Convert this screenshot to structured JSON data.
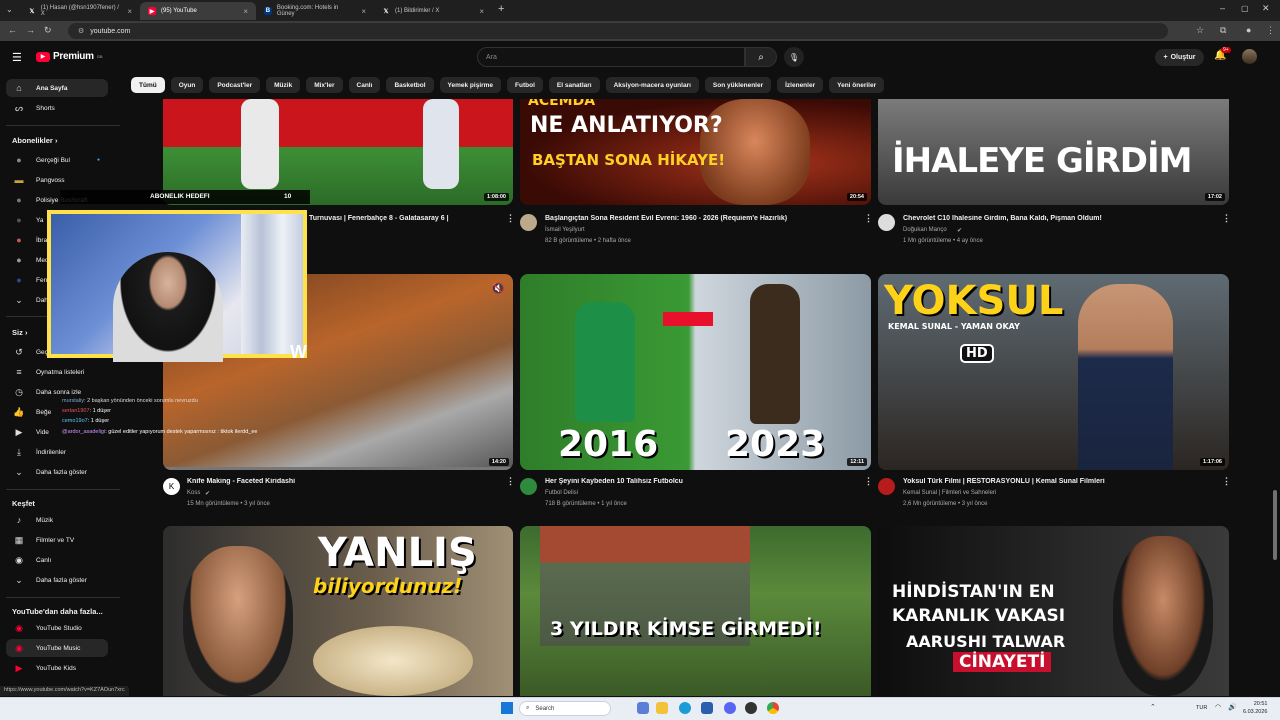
{
  "browser": {
    "tabs": [
      {
        "label": "(1) Hasan (@hsn1907fener) / X",
        "active": false
      },
      {
        "label": "(95) YouTube",
        "active": true
      },
      {
        "label": "Booking.com: Hotels in Güney",
        "active": false
      },
      {
        "label": "(1) Bildirimler / X",
        "active": false
      }
    ],
    "url": "youtube.com",
    "status_url": "https://www.youtube.com/watch?v=KZ7AOun7xrc"
  },
  "header": {
    "logo": "Premium",
    "logo_sup": "GB",
    "search_placeholder": "Ara",
    "create_label": "Oluştur",
    "notif_badge": "9+"
  },
  "chips": [
    "Tümü",
    "Oyun",
    "Podcast'ler",
    "Müzik",
    "Mix'ler",
    "Canlı",
    "Basketbol",
    "Yemek pişirme",
    "Futbol",
    "El sanatları",
    "Aksiyon-macera oyunları",
    "Son yüklenenler",
    "İzlenenler",
    "Yeni öneriler"
  ],
  "sidebar": {
    "home": "Ana Sayfa",
    "shorts": "Shorts",
    "subs_head": "Abonelikler",
    "subs": [
      "Gerçeği Bul",
      "Pangvoss",
      "Polisiye Bushcraft",
      "Ya",
      "İbra",
      "Mec",
      "Fen",
      "Dah"
    ],
    "you_head": "Siz",
    "you_items": [
      "Geç",
      "Oynatma listeleri",
      "Daha sonra izle",
      "Beğe",
      "Vide",
      "İndirilenler",
      "Daha fazla göster"
    ],
    "explore_head": "Keşfet",
    "explore_items": [
      "Müzik",
      "Filmler ve TV",
      "Canlı",
      "Daha fazla göster"
    ],
    "more_head": "YouTube'dan daha fazla...",
    "more_items": [
      "YouTube Studio",
      "YouTube Music",
      "YouTube Kids"
    ]
  },
  "overlay": {
    "goal_label": "ABONELIK HEDEFI",
    "goal_value": "10",
    "chat": [
      {
        "user": "murstaliy",
        "text": ": 2 başkan yönünden önceki sorumlu nevruzdu"
      },
      {
        "user": "sertan1907",
        "text": ": 1 düşer"
      },
      {
        "user": "cemo19o7",
        "text": ": 1 düşer"
      },
      {
        "user": "@ardor_asadeligi",
        "text": ": güzel editler yapıyorum destek yaparmısınız : tiktok ilerdd_ee"
      }
    ]
  },
  "videos": [
    {
      "title": "Turnuvası | Fenerbahçe 8 - Galatasaray 6 |",
      "channel": "",
      "meta": "",
      "duration": "1:08:00",
      "thumb_text": ""
    },
    {
      "title": "Başlangıçtan Sona Resident Evil Evreni: 1960 - 2026 (Requiem'e Hazırlık)",
      "channel": "İsmail Yeşilyurt",
      "meta": "82 B görüntüleme • 2 hafta önce",
      "duration": "20:54",
      "thumb_text": "NE ANLATIYOR?",
      "thumb_text2": "BAŞTAN SONA HİKAYE!",
      "thumb_text3": "ACEMDA"
    },
    {
      "title": "Chevrolet C10 İhalesine Girdim, Bana Kaldı, Pişman Oldum!",
      "channel": "Doğukan Manço",
      "meta": "1 Mn görüntüleme • 4 ay önce",
      "duration": "17:02",
      "thumb_text": "İHALEYE GİRDİM"
    },
    {
      "title": "Knife Making - Faceted Kiridashi",
      "channel": "Koss",
      "meta": "15 Mn görüntüleme • 3 yıl önce",
      "duration": "14:20",
      "thumb_text": ""
    },
    {
      "title": "Her Şeyini Kaybeden 10 Talihsiz Futbolcu",
      "channel": "Futbol Delisi",
      "meta": "718 B görüntüleme • 1 yıl önce",
      "duration": "12:11",
      "thumb_text": "2016",
      "thumb_text2": "2023"
    },
    {
      "title": "Yoksul Türk Filmi | RESTORASYONLU | Kemal Sunal Filmleri",
      "channel": "Kemal Sunal | Filmleri ve Sahneleri",
      "meta": "2,6 Mn görüntüleme • 3 yıl önce",
      "duration": "1:17:06",
      "thumb_text": "YOKSUL",
      "thumb_text2": "KEMAL SUNAL - YAMAN OKAY",
      "thumb_text3": "HD"
    },
    {
      "title": "",
      "channel": "",
      "meta": "",
      "duration": "",
      "thumb_text": "YANLIŞ",
      "thumb_text2": "biliyordunuz!"
    },
    {
      "title": "",
      "channel": "",
      "meta": "",
      "duration": "",
      "thumb_text": "3 YILDIR KİMSE GİRMEDİ!"
    },
    {
      "title": "",
      "channel": "",
      "meta": "",
      "duration": "",
      "thumb_text": "HİNDİSTAN'IN EN",
      "thumb_text2": "KARANLIK VAKASI",
      "thumb_text3": "AARUSHI TALWAR",
      "thumb_text4": "CİNAYETİ"
    }
  ],
  "taskbar": {
    "search": "Search",
    "lang": "TUR",
    "time": "20:51",
    "date": "6.03.2026"
  },
  "colors": {
    "accent": "#ff0033",
    "overlay_border": "#ffe14a",
    "bg": "#0f0f0f"
  }
}
